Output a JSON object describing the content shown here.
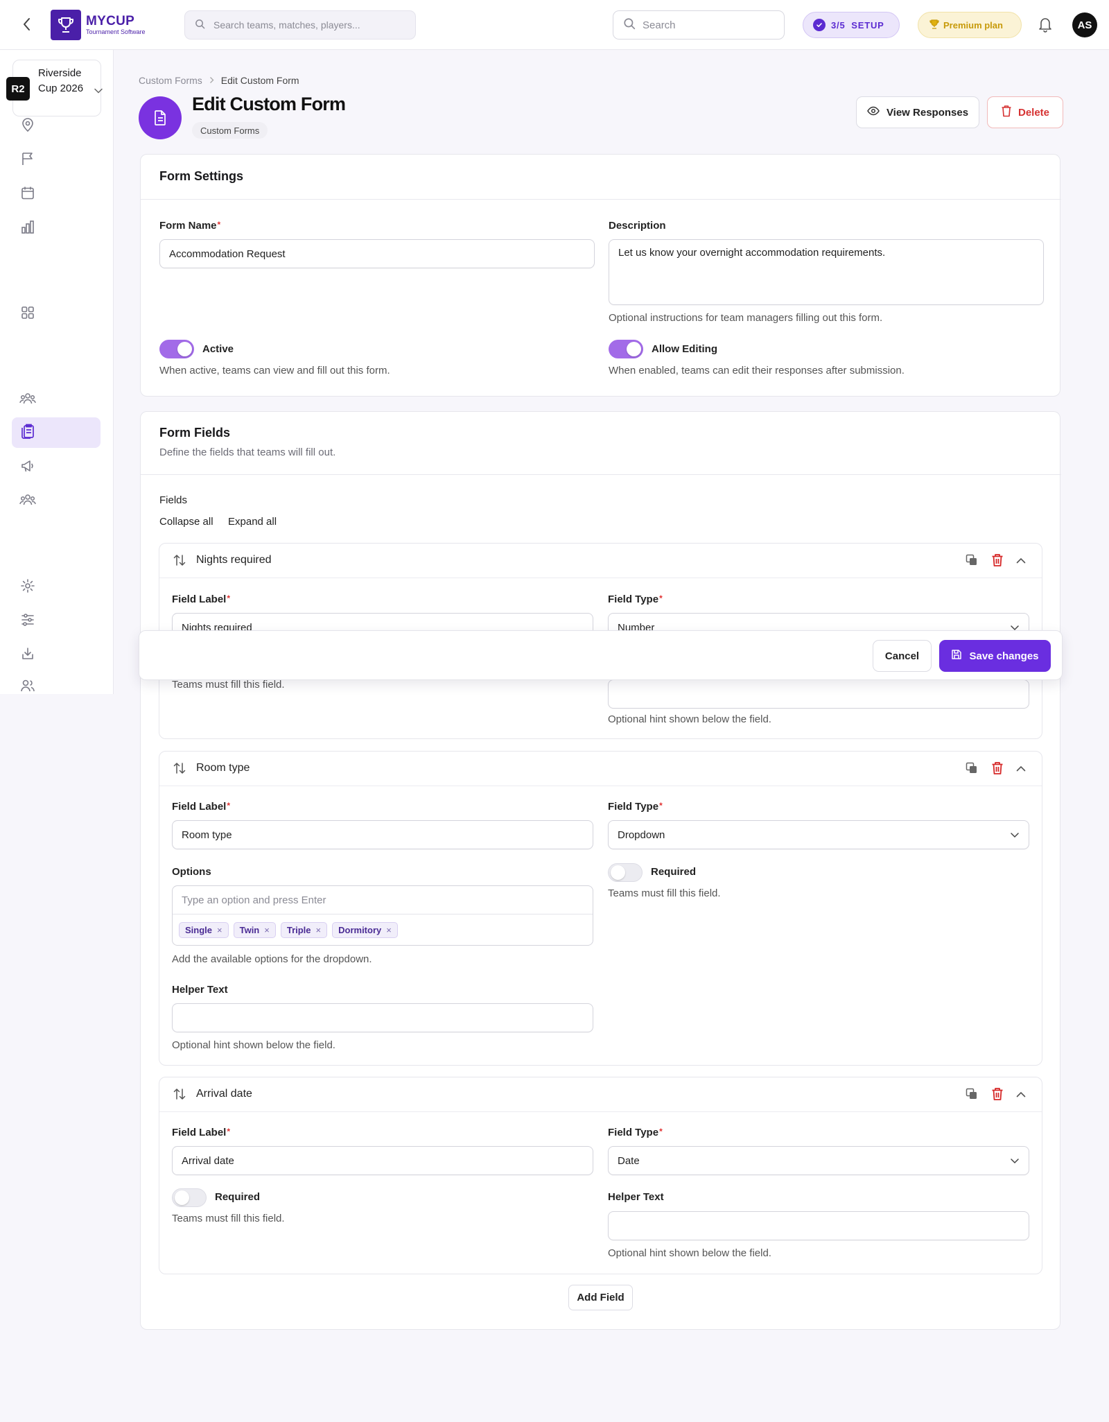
{
  "brand": {
    "title": "MYCUP",
    "subtitle": "Tournament Software"
  },
  "topbar": {
    "global_search_placeholder": "Search teams, matches, players...",
    "search_placeholder": "Search",
    "setup_label": "3/5  SETUP",
    "premium_label": "Premium plan",
    "avatar_initials": "AS"
  },
  "sidebar": {
    "tournament_badge": "R2",
    "tournament_name": "Riverside Cup 2026"
  },
  "breadcrumb": {
    "parent": "Custom Forms",
    "current": "Edit Custom Form"
  },
  "page": {
    "title": "Edit Custom Form",
    "chip": "Custom Forms"
  },
  "actions": {
    "view_responses": "View Responses",
    "delete": "Delete"
  },
  "form_settings": {
    "title": "Form Settings",
    "form_name_label": "Form Name",
    "form_name_value": "Accommodation Request",
    "description_label": "Description",
    "description_value": "Let us know your overnight accommodation requirements.",
    "description_hint": "Optional instructions for team managers filling out this form.",
    "active_label": "Active",
    "active_hint": "When active, teams can view and fill out this form.",
    "active_on": true,
    "allow_editing_label": "Allow Editing",
    "allow_editing_hint": "When enabled, teams can edit their responses after submission.",
    "allow_editing_on": true
  },
  "form_fields": {
    "title": "Form Fields",
    "subtitle": "Define the fields that teams will fill out.",
    "fields_label": "Fields",
    "collapse_all": "Collapse all",
    "expand_all": "Expand all",
    "field_label_label": "Field Label",
    "field_type_label": "Field Type",
    "required_label": "Required",
    "required_hint": "Teams must fill this field.",
    "helper_label": "Helper Text",
    "helper_hint": "Optional hint shown below the field.",
    "items": [
      {
        "title": "Nights required",
        "label_value": "Nights required",
        "type_value": "Number"
      },
      {
        "title": "Room type",
        "label_value": "Room type",
        "type_value": "Dropdown",
        "options_label": "Options",
        "options_placeholder": "Type an option and press Enter",
        "options": [
          "Single",
          "Twin",
          "Triple",
          "Dormitory"
        ],
        "options_hint": "Add the available options for the dropdown.",
        "required_on": false
      },
      {
        "title": "Arrival date",
        "label_value": "Arrival date",
        "type_value": "Date",
        "required_on": false
      }
    ],
    "add_field": "Add Field"
  },
  "save_bar": {
    "cancel": "Cancel",
    "save": "Save changes"
  },
  "colors": {
    "accent": "#6a2ee0",
    "danger": "#d63232",
    "premium": "#c79a0a"
  }
}
